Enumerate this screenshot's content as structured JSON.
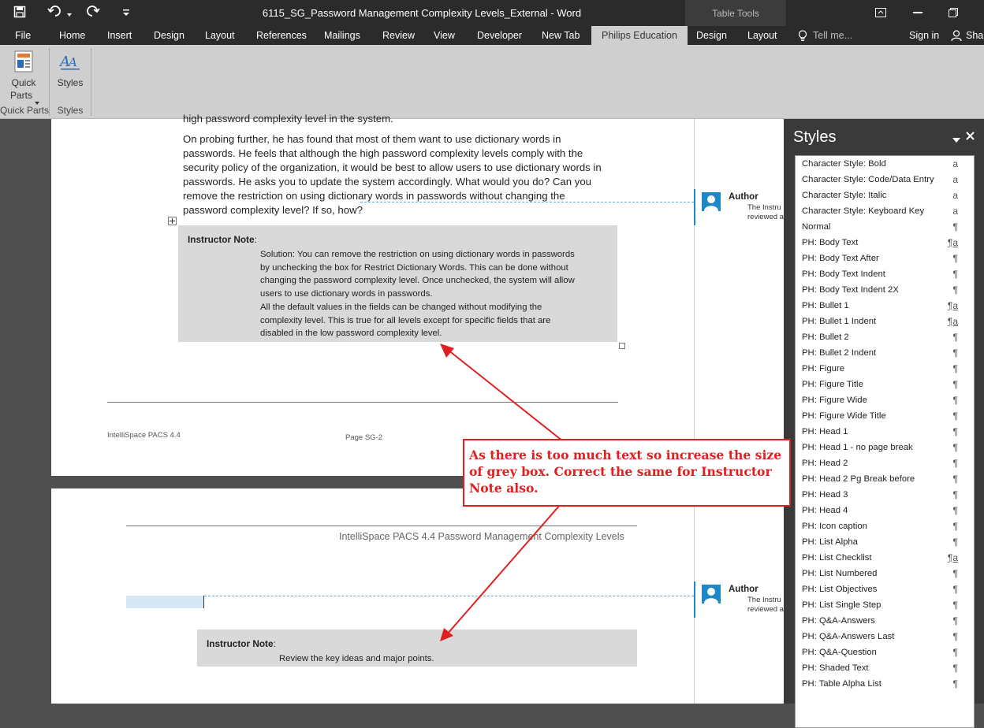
{
  "window": {
    "title": "6115_SG_Password Management Complexity Levels_External - Word",
    "context_tab_group": "Table Tools"
  },
  "tabs": [
    "File",
    "Home",
    "Insert",
    "Design",
    "Layout",
    "References",
    "Mailings",
    "Review",
    "View",
    "Developer",
    "New Tab",
    "Philips Education",
    "Design",
    "Layout"
  ],
  "tell_me": "Tell me...",
  "sign_in": "Sign in",
  "share": "Shar",
  "ribbon": {
    "quick_parts_line1": "Quick",
    "quick_parts_line2": "Parts",
    "quick_parts_group": "Quick Parts",
    "styles_button": "Styles",
    "styles_group": "Styles"
  },
  "page1": {
    "top_fragment": "high password complexity level in the system.",
    "paragraph_lines": [
      "On probing further, he has found that most of them want to use dictionary words in",
      "passwords. He feels that although the high password complexity levels comply with the",
      "security policy of the organization, it would be best to allow users to use dictionary words in",
      "passwords. He asks you to update the system accordingly. What would you do? Can you",
      "remove the restriction on using dictionary words in passwords without changing the",
      "password complexity level? If so, how?"
    ],
    "note_heading": "Instructor Note",
    "note_colon": ":",
    "solution_lines": [
      "Solution: You can remove the restriction on using dictionary words in passwords",
      "by unchecking the box for Restrict Dictionary Words. This can be done without",
      "changing the password complexity level. Once unchecked, the system will allow",
      "users to use dictionary words in passwords."
    ],
    "defaults_lines": [
      "All the default values in the fields can be changed without modifying the",
      "complexity level. This is true for all levels except for specific fields that are",
      "disabled in the low password complexity level."
    ],
    "footer_left": "IntelliSpace PACS 4.4",
    "footer_center": "Page SG-2"
  },
  "page2": {
    "header_text": "IntelliSpace PACS 4.4 Password Management Complexity Levels",
    "note_heading": "Instructor Note",
    "note_colon": ":",
    "note_text": "Review the key ideas and major points."
  },
  "comments": [
    {
      "author": "Author",
      "line1": "The Instru",
      "line2": "reviewed a"
    },
    {
      "author": "Author",
      "line1": "The Instru",
      "line2": "reviewed a"
    }
  ],
  "callout": {
    "text": "As there is too much text so increase the size of grey box. Correct the same for Instructor Note also."
  },
  "styles_pane": {
    "title": "Styles",
    "items": [
      {
        "name": "Character Style: Bold",
        "symbol": "a"
      },
      {
        "name": "Character Style: Code/Data Entry",
        "symbol": "a"
      },
      {
        "name": "Character Style: Italic",
        "symbol": "a"
      },
      {
        "name": "Character Style: Keyboard Key",
        "symbol": "a"
      },
      {
        "name": "Normal",
        "symbol": "¶"
      },
      {
        "name": "PH: Body Text",
        "symbol": "¶a"
      },
      {
        "name": "PH: Body Text After",
        "symbol": "¶"
      },
      {
        "name": "PH: Body Text Indent",
        "symbol": "¶"
      },
      {
        "name": "PH: Body Text Indent 2X",
        "symbol": "¶"
      },
      {
        "name": "PH: Bullet 1",
        "symbol": "¶a"
      },
      {
        "name": "PH: Bullet 1 Indent",
        "symbol": "¶a"
      },
      {
        "name": "PH: Bullet 2",
        "symbol": "¶"
      },
      {
        "name": "PH: Bullet 2 Indent",
        "symbol": "¶"
      },
      {
        "name": "PH: Figure",
        "symbol": "¶"
      },
      {
        "name": "PH: Figure Title",
        "symbol": "¶"
      },
      {
        "name": "PH: Figure Wide",
        "symbol": "¶"
      },
      {
        "name": "PH: Figure Wide Title",
        "symbol": "¶"
      },
      {
        "name": "PH: Head 1",
        "symbol": "¶"
      },
      {
        "name": "PH: Head 1 - no page break",
        "symbol": "¶"
      },
      {
        "name": "PH: Head 2",
        "symbol": "¶"
      },
      {
        "name": "PH: Head 2 Pg Break before",
        "symbol": "¶"
      },
      {
        "name": "PH: Head 3",
        "symbol": "¶"
      },
      {
        "name": "PH: Head 4",
        "symbol": "¶"
      },
      {
        "name": "PH: Icon caption",
        "symbol": "¶"
      },
      {
        "name": "PH: List Alpha",
        "symbol": "¶"
      },
      {
        "name": "PH: List Checklist",
        "symbol": "¶a"
      },
      {
        "name": "PH: List Numbered",
        "symbol": "¶"
      },
      {
        "name": "PH: List Objectives",
        "symbol": "¶"
      },
      {
        "name": "PH: List Single Step",
        "symbol": "¶"
      },
      {
        "name": "PH: Q&A-Answers",
        "symbol": "¶"
      },
      {
        "name": "PH: Q&A-Answers Last",
        "symbol": "¶"
      },
      {
        "name": "PH: Q&A-Question",
        "symbol": "¶"
      },
      {
        "name": "PH: Shaded Text",
        "symbol": "¶"
      },
      {
        "name": "PH: Table Alpha List",
        "symbol": "¶"
      }
    ]
  },
  "colors": {
    "title_bar": "#2b2b2b",
    "ribbon": "#cfcfcf",
    "note_box": "#d9d9d9",
    "annotation_red": "#e02020",
    "comment_blue": "#1e88c7"
  }
}
